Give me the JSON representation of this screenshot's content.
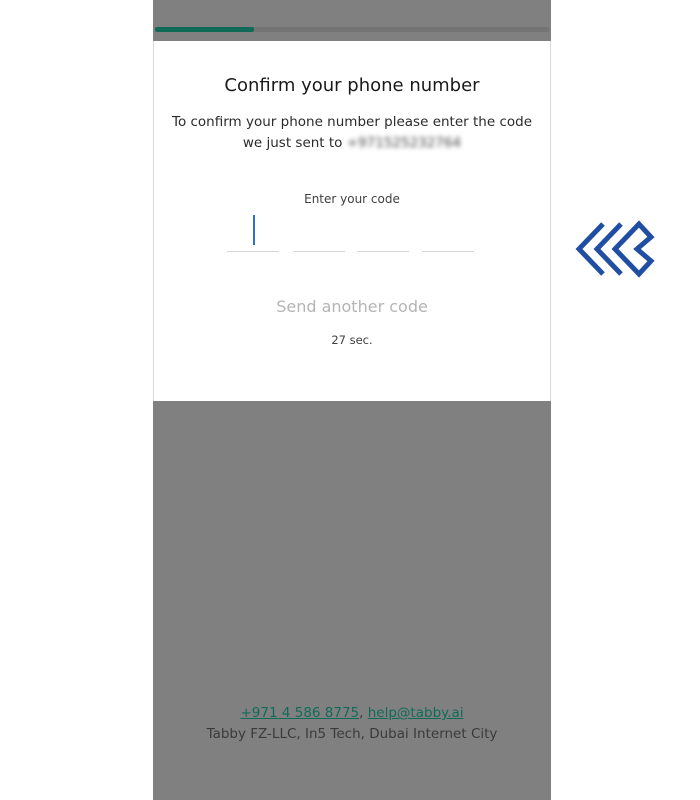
{
  "progress": {
    "fraction": 0.25,
    "fill_color": "#0f6b57",
    "track_color": "#747474"
  },
  "card": {
    "title": "Confirm your phone number",
    "description": "To confirm your phone number please enter the code we just sent to",
    "phone_number_blurred": "+971525232764",
    "code_label": "Enter your code",
    "code_digits": [
      "",
      "",
      "",
      ""
    ],
    "resend_label": "Send another code",
    "timer": "27 sec."
  },
  "footer": {
    "phone_link": "+971 4 586 8775",
    "separator": ",",
    "email_link": "help@tabby.ai",
    "address": "Tabby FZ-LLC, In5 Tech, Dubai Internet City",
    "link_color": "#0f6b57"
  },
  "logo": {
    "icon": "double-chevron-left-logo",
    "color": "#1f4ea3"
  },
  "colors": {
    "overlay": "#808080",
    "caret": "#2f6fd0"
  }
}
